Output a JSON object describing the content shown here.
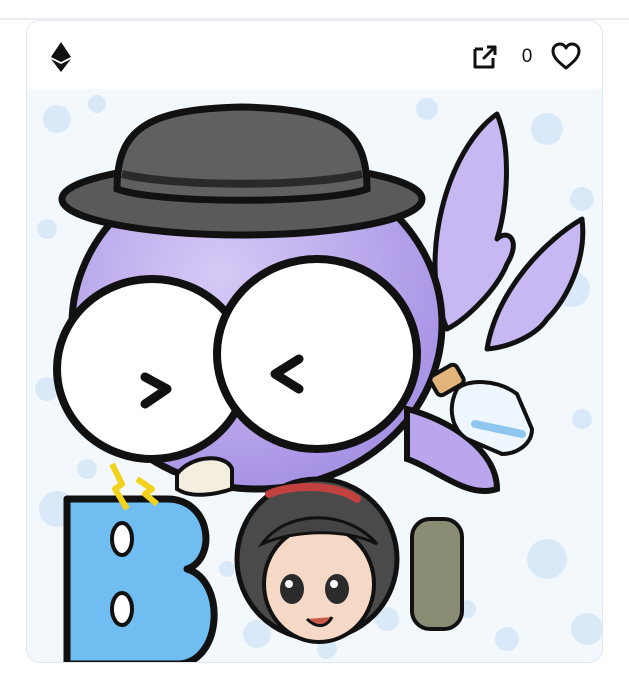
{
  "card": {
    "chain_icon": "ethereum-icon",
    "open_icon": "open-in-new-icon",
    "like_icon": "heart-outline-icon",
    "like_count": "0",
    "artwork": {
      "description_icon": "artwork-image",
      "badge_letter": "B",
      "colors": {
        "body": "#b9a6ec",
        "hat": "#5a5a5a",
        "letter": "#6fbdf1",
        "outline": "#111111",
        "bubbles": "#cfe3f6"
      }
    }
  }
}
